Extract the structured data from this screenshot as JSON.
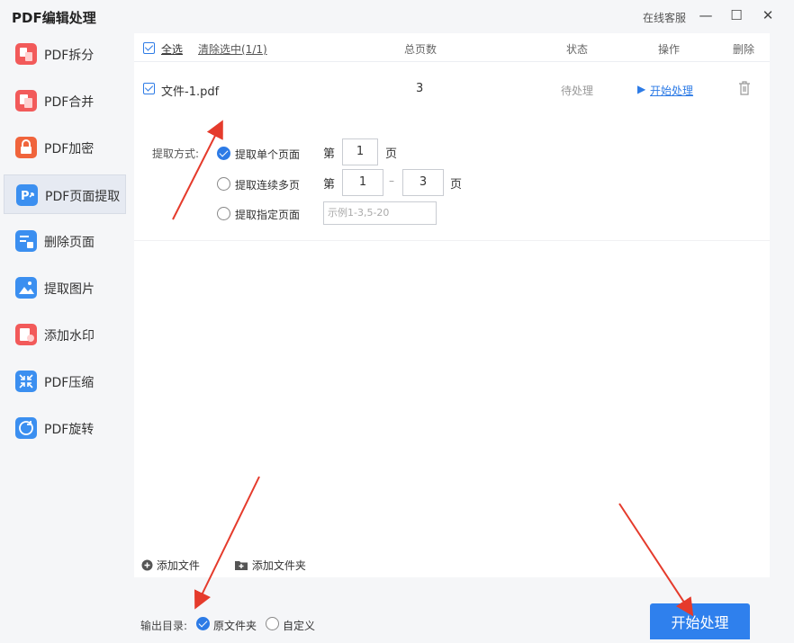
{
  "app_title": "PDF编辑处理",
  "window": {
    "support": "在线客服",
    "minimize": "—",
    "maximize": "☐",
    "close": "✕"
  },
  "sidebar": {
    "items": [
      {
        "label": "PDF拆分",
        "icon": "split-icon",
        "color": "#f25a5a"
      },
      {
        "label": "PDF合并",
        "icon": "merge-icon",
        "color": "#f25a5a"
      },
      {
        "label": "PDF加密",
        "icon": "lock-icon",
        "color": "#f0643c"
      },
      {
        "label": "PDF页面提取",
        "icon": "extract-page-icon",
        "color": "#3b8ff0"
      },
      {
        "label": "删除页面",
        "icon": "delete-page-icon",
        "color": "#3b8ff0"
      },
      {
        "label": "提取图片",
        "icon": "image-icon",
        "color": "#3b8ff0"
      },
      {
        "label": "添加水印",
        "icon": "watermark-icon",
        "color": "#f25a5a"
      },
      {
        "label": "PDF压缩",
        "icon": "compress-icon",
        "color": "#3b8ff0"
      },
      {
        "label": "PDF旋转",
        "icon": "rotate-icon",
        "color": "#3b8ff0"
      }
    ]
  },
  "table": {
    "select_all": "全选",
    "clear_selection": "清除选中(1/1)",
    "columns": {
      "pages": "总页数",
      "status": "状态",
      "action": "操作",
      "delete": "删除"
    },
    "row": {
      "file": "文件-1.pdf",
      "pages": "3",
      "status": "待处理",
      "action": "开始处理"
    }
  },
  "extract": {
    "method_label": "提取方式:",
    "options": [
      "提取单个页面",
      "提取连续多页",
      "提取指定页面"
    ],
    "page_prefix": "第",
    "page_suffix": "页",
    "single_page": "1",
    "range_from": "1",
    "range_sep": "–",
    "range_to": "3",
    "specified_placeholder": "示例1-3,5-20"
  },
  "footer": {
    "add_file": "添加文件",
    "add_folder": "添加文件夹"
  },
  "output": {
    "label": "输出目录:",
    "original": "原文件夹",
    "custom": "自定义"
  },
  "start_button": "开始处理",
  "colors": {
    "accent": "#2f80ed",
    "arrow": "#e53b2c"
  }
}
